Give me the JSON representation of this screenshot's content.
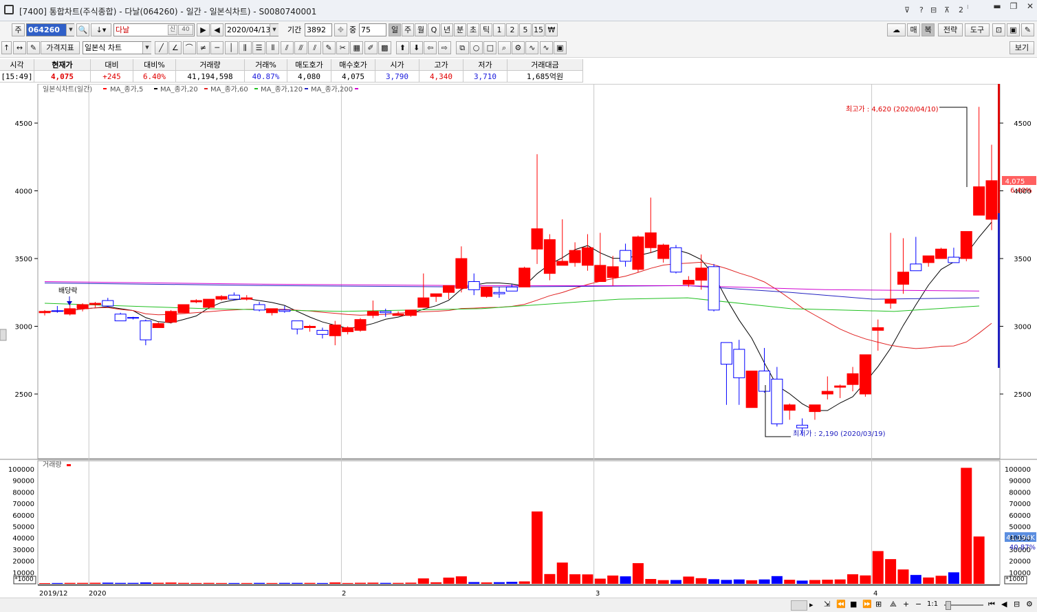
{
  "window": {
    "title": "[7400]  통합차트(주식종합) - 다날(064260) - 일간 - 일본식차트) - S0080740001",
    "title_icons": [
      "pin-icon",
      "help-icon",
      "layout-icon",
      "tile-icon",
      "number-icon"
    ],
    "tile_label": "2",
    "controls": [
      "minimize-icon",
      "restore-icon",
      "close-icon"
    ]
  },
  "toolbar1": {
    "type_label": "주",
    "code": "064260",
    "name": "다날",
    "credit_badge": "신",
    "margin_badge": "40",
    "date": "2020/04/13",
    "period_label": "기간",
    "period_value": "3892",
    "count_label": "중",
    "count_value": "75",
    "intervals": [
      "일",
      "주",
      "월",
      "Q",
      "년",
      "분",
      "초",
      "틱",
      "1",
      "2",
      "5",
      "15",
      "₩"
    ],
    "selected_interval": "일",
    "right_buttons": [
      "매",
      "복",
      "전략",
      "도구"
    ]
  },
  "toolbar2": {
    "indicator_button": "가격지표",
    "chart_type": "일본식 차트",
    "view_button": "보기"
  },
  "quote": {
    "headers": [
      "시각",
      "현재가",
      "대비",
      "대비%",
      "거래량",
      "거래%",
      "매도호가",
      "매수호가",
      "시가",
      "고가",
      "저가",
      "거래대금"
    ],
    "values": [
      "[15:49]",
      "4,075",
      "+245",
      "6.40%",
      "41,194,598",
      "40.87%",
      "4,080",
      "4,075",
      "3,790",
      "4,340",
      "3,710",
      "1,685억원"
    ]
  },
  "chart": {
    "price_legend": "일본식차트(일간)",
    "ma_legend": [
      "MA_종가,5",
      "MA_종가,20",
      "MA_종가,60",
      "MA_종가,120",
      "MA_종가,200"
    ],
    "colors": {
      "up": "#ff0000",
      "down": "#0000ff",
      "ma5": "#000000",
      "ma20": "#e02020",
      "ma60": "#20c020",
      "ma120": "#2020c0",
      "ma200": "#d000d0"
    },
    "price_ticks": [
      2500,
      3000,
      3500,
      4000,
      4500
    ],
    "volume_legend": "거래량",
    "volume_ticks": [
      "100000",
      "90000",
      "80000",
      "70000",
      "60000",
      "50000",
      "40000",
      "30000",
      "20000",
      "10000"
    ],
    "volume_unit": "*1000",
    "x_labels": [
      "2019/12",
      "2020",
      "2",
      "3",
      "4"
    ],
    "high_annotation": "최고가 : 4,620 (2020/04/10)",
    "low_annotation": "최저가 : 2,190 (2020/03/19)",
    "dividend_label": "배당락",
    "last_price_badge": "4,075",
    "last_pct_badge": "6.40%",
    "last_volume_badge": "41,194K",
    "last_volume_pct": "40.87%"
  },
  "chart_data": {
    "type": "candlestick",
    "price_range": [
      2190,
      4750
    ],
    "volume_range": [
      0,
      102000
    ],
    "candles": [
      {
        "o": 3100,
        "h": 3120,
        "l": 3080,
        "c": 3110
      },
      {
        "o": 3115,
        "h": 3150,
        "l": 3100,
        "c": 3110
      },
      {
        "o": 3090,
        "h": 3160,
        "l": 3080,
        "c": 3130
      },
      {
        "o": 3130,
        "h": 3170,
        "l": 3110,
        "c": 3160
      },
      {
        "o": 3160,
        "h": 3180,
        "l": 3140,
        "c": 3170
      },
      {
        "o": 3190,
        "h": 3210,
        "l": 3140,
        "c": 3150
      },
      {
        "o": 3090,
        "h": 3100,
        "l": 3040,
        "c": 3040
      },
      {
        "o": 3065,
        "h": 3070,
        "l": 3050,
        "c": 3060
      },
      {
        "o": 3040,
        "h": 3050,
        "l": 2860,
        "c": 2900
      },
      {
        "o": 2990,
        "h": 3030,
        "l": 2990,
        "c": 3020
      },
      {
        "o": 3030,
        "h": 3120,
        "l": 3020,
        "c": 3110
      },
      {
        "o": 3100,
        "h": 3160,
        "l": 3100,
        "c": 3160
      },
      {
        "o": 3180,
        "h": 3200,
        "l": 3170,
        "c": 3190
      },
      {
        "o": 3140,
        "h": 3200,
        "l": 3130,
        "c": 3200
      },
      {
        "o": 3200,
        "h": 3230,
        "l": 3190,
        "c": 3220
      },
      {
        "o": 3230,
        "h": 3250,
        "l": 3190,
        "c": 3200
      },
      {
        "o": 3200,
        "h": 3230,
        "l": 3190,
        "c": 3210
      },
      {
        "o": 3160,
        "h": 3180,
        "l": 3110,
        "c": 3120
      },
      {
        "o": 3100,
        "h": 3120,
        "l": 3080,
        "c": 3130
      },
      {
        "o": 3120,
        "h": 3150,
        "l": 3100,
        "c": 3110
      },
      {
        "o": 3040,
        "h": 3040,
        "l": 2940,
        "c": 2980
      },
      {
        "o": 2990,
        "h": 3010,
        "l": 2960,
        "c": 3000
      },
      {
        "o": 2970,
        "h": 2990,
        "l": 2910,
        "c": 2940
      },
      {
        "o": 2930,
        "h": 3040,
        "l": 2860,
        "c": 3010
      },
      {
        "o": 2960,
        "h": 3000,
        "l": 2940,
        "c": 2990
      },
      {
        "o": 2970,
        "h": 3060,
        "l": 2960,
        "c": 3050
      },
      {
        "o": 3080,
        "h": 3190,
        "l": 3060,
        "c": 3110
      },
      {
        "o": 3110,
        "h": 3130,
        "l": 3070,
        "c": 3100
      },
      {
        "o": 3080,
        "h": 3110,
        "l": 3080,
        "c": 3090
      },
      {
        "o": 3080,
        "h": 3120,
        "l": 3070,
        "c": 3120
      },
      {
        "o": 3140,
        "h": 3390,
        "l": 3140,
        "c": 3210
      },
      {
        "o": 3220,
        "h": 3240,
        "l": 3180,
        "c": 3240
      },
      {
        "o": 3250,
        "h": 3260,
        "l": 3200,
        "c": 3300
      },
      {
        "o": 3280,
        "h": 3590,
        "l": 3250,
        "c": 3500
      },
      {
        "o": 3330,
        "h": 3390,
        "l": 3230,
        "c": 3270
      },
      {
        "o": 3220,
        "h": 3240,
        "l": 3210,
        "c": 3290
      },
      {
        "o": 3250,
        "h": 3290,
        "l": 3210,
        "c": 3240
      },
      {
        "o": 3290,
        "h": 3310,
        "l": 3260,
        "c": 3260
      },
      {
        "o": 3290,
        "h": 3440,
        "l": 3290,
        "c": 3430
      },
      {
        "o": 3570,
        "h": 4270,
        "l": 3460,
        "c": 3720
      },
      {
        "o": 3390,
        "h": 3680,
        "l": 3340,
        "c": 3640
      },
      {
        "o": 3450,
        "h": 3790,
        "l": 3450,
        "c": 3480
      },
      {
        "o": 3470,
        "h": 3620,
        "l": 3440,
        "c": 3560
      },
      {
        "o": 3450,
        "h": 3680,
        "l": 3410,
        "c": 3580
      },
      {
        "o": 3330,
        "h": 3690,
        "l": 3330,
        "c": 3450
      },
      {
        "o": 3360,
        "h": 3520,
        "l": 3300,
        "c": 3440
      },
      {
        "o": 3560,
        "h": 3610,
        "l": 3440,
        "c": 3480
      },
      {
        "o": 3420,
        "h": 3670,
        "l": 3400,
        "c": 3660
      },
      {
        "o": 3580,
        "h": 3950,
        "l": 3540,
        "c": 3690
      },
      {
        "o": 3500,
        "h": 3610,
        "l": 3470,
        "c": 3600
      },
      {
        "o": 3580,
        "h": 3600,
        "l": 3390,
        "c": 3400
      },
      {
        "o": 3310,
        "h": 3370,
        "l": 3290,
        "c": 3340
      },
      {
        "o": 3340,
        "h": 3530,
        "l": 3270,
        "c": 3430
      },
      {
        "o": 3440,
        "h": 3460,
        "l": 3110,
        "c": 3120
      },
      {
        "o": 2880,
        "h": 2880,
        "l": 2420,
        "c": 2720
      },
      {
        "o": 2830,
        "h": 2900,
        "l": 2420,
        "c": 2620
      },
      {
        "o": 2400,
        "h": 2660,
        "l": 2400,
        "c": 2670
      },
      {
        "o": 2670,
        "h": 2840,
        "l": 2510,
        "c": 2520
      },
      {
        "o": 2610,
        "h": 2700,
        "l": 2260,
        "c": 2280
      },
      {
        "o": 2380,
        "h": 2430,
        "l": 2310,
        "c": 2420
      },
      {
        "o": 2270,
        "h": 2320,
        "l": 2190,
        "c": 2250
      },
      {
        "o": 2370,
        "h": 2420,
        "l": 2310,
        "c": 2420
      },
      {
        "o": 2500,
        "h": 2630,
        "l": 2460,
        "c": 2520
      },
      {
        "o": 2550,
        "h": 2570,
        "l": 2470,
        "c": 2560
      },
      {
        "o": 2570,
        "h": 2700,
        "l": 2520,
        "c": 2650
      },
      {
        "o": 2500,
        "h": 2790,
        "l": 2480,
        "c": 2790
      },
      {
        "o": 2970,
        "h": 3050,
        "l": 2820,
        "c": 2990
      },
      {
        "o": 3170,
        "h": 3690,
        "l": 3130,
        "c": 3200
      },
      {
        "o": 3310,
        "h": 3650,
        "l": 3240,
        "c": 3400
      },
      {
        "o": 3460,
        "h": 3660,
        "l": 3450,
        "c": 3410
      },
      {
        "o": 3470,
        "h": 3510,
        "l": 3440,
        "c": 3520
      },
      {
        "o": 3500,
        "h": 3580,
        "l": 3500,
        "c": 3570
      },
      {
        "o": 3510,
        "h": 3580,
        "l": 3480,
        "c": 3470
      },
      {
        "o": 3500,
        "h": 3520,
        "l": 3480,
        "c": 3700
      },
      {
        "o": 3820,
        "h": 4620,
        "l": 3820,
        "c": 4030
      },
      {
        "o": 3790,
        "h": 4340,
        "l": 3710,
        "c": 4075
      }
    ],
    "volume": [
      600,
      700,
      800,
      800,
      900,
      1000,
      800,
      800,
      1200,
      900,
      1100,
      800,
      700,
      800,
      700,
      700,
      700,
      800,
      700,
      800,
      800,
      800,
      700,
      1200,
      700,
      900,
      1000,
      800,
      800,
      1000,
      4700,
      1300,
      5400,
      6500,
      1500,
      1200,
      1400,
      1700,
      2100,
      63000,
      8500,
      18500,
      8300,
      8200,
      4500,
      7200,
      6500,
      18000,
      4200,
      3200,
      3300,
      6300,
      4900,
      4000,
      3400,
      3800,
      3100,
      3800,
      6700,
      3500,
      2800,
      3300,
      3600,
      3800,
      8300,
      7300,
      28500,
      21500,
      12500,
      7700,
      5500,
      7000,
      10000,
      101000,
      41194
    ]
  }
}
